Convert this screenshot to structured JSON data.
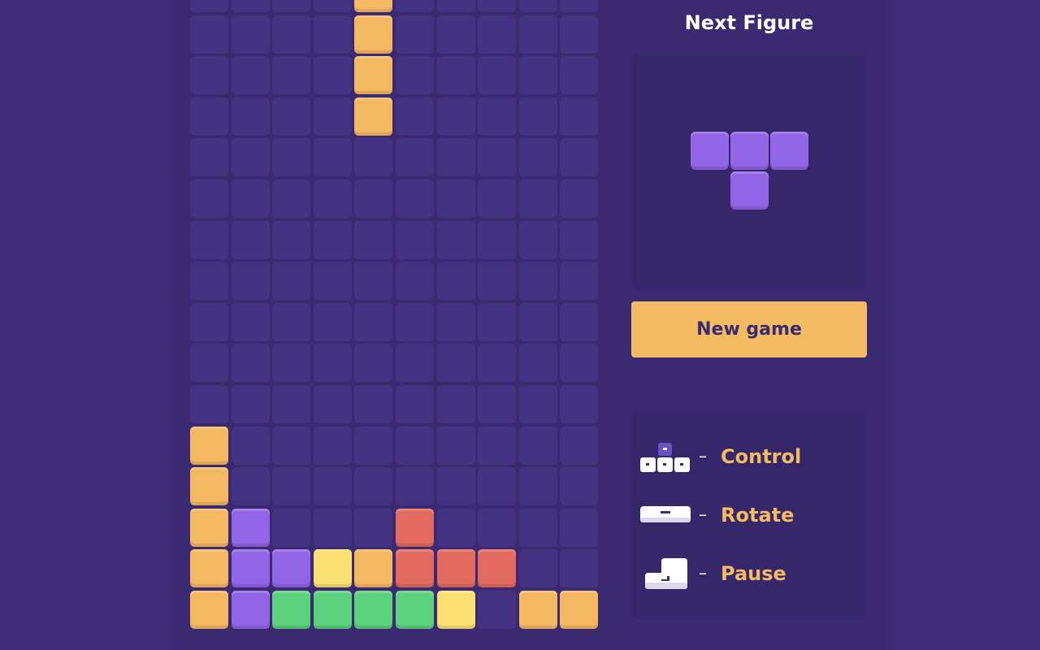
{
  "colors": {
    "background": "#3d2b78",
    "empty_cell": "#433382",
    "orange": "#f5b862",
    "purple": "#9265e6",
    "yellow": "#f9e071",
    "red": "#e36a5e",
    "green": "#5cd17e",
    "accent": "#f4bc62"
  },
  "board": {
    "columns": 10,
    "rows": 16,
    "grid": [
      "....O.....",
      "....O.....",
      "....O.....",
      "....O.....",
      "..........",
      "..........",
      "..........",
      "..........",
      "..........",
      "..........",
      "..........",
      "O.........",
      "O.........",
      "OP...R....",
      "OPPYORRR..",
      "OPGGGGY.OO"
    ],
    "legend": {
      "O": "orange",
      "P": "purple",
      "Y": "yellow",
      "R": "red",
      "G": "green"
    }
  },
  "next_figure": {
    "title": "Next Figure",
    "shape": [
      "PPP",
      ".P."
    ],
    "color": "purple"
  },
  "new_game_label": "New game",
  "controls": [
    {
      "icon": "arrow-keys-icon",
      "dash": "–",
      "label": "Control"
    },
    {
      "icon": "spacebar-icon",
      "dash": "–",
      "label": "Rotate"
    },
    {
      "icon": "enter-key-icon",
      "dash": "–",
      "label": "Pause"
    }
  ]
}
